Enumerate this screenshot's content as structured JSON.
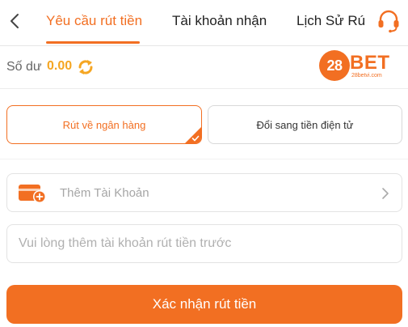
{
  "header": {
    "tabs": [
      {
        "label": "Yêu cầu rút tiền",
        "active": true
      },
      {
        "label": "Tài khoản nhận",
        "active": false
      },
      {
        "label": "Lịch Sử Rú",
        "active": false
      }
    ],
    "back_icon": "chevron-left-icon",
    "support_icon": "headset-icon"
  },
  "balance": {
    "label": "Số dư",
    "value": "0.00",
    "refresh_icon": "refresh-icon"
  },
  "logo": {
    "number": "28",
    "brand": "BET",
    "domain": "28betvi.com"
  },
  "withdraw_options": {
    "bank": "Rút về ngân hàng",
    "crypto": "Đổi sang tiền điện tử",
    "selected": "bank"
  },
  "add_account": {
    "label": "Thêm Tài Khoản",
    "icon": "wallet-add-icon"
  },
  "amount": {
    "placeholder": "Vui lòng thêm tài khoản rút tiền trước",
    "value": ""
  },
  "confirm": {
    "label": "Xác nhận rút tiền"
  },
  "colors": {
    "accent": "#f26f22",
    "balance": "#f5a623"
  }
}
